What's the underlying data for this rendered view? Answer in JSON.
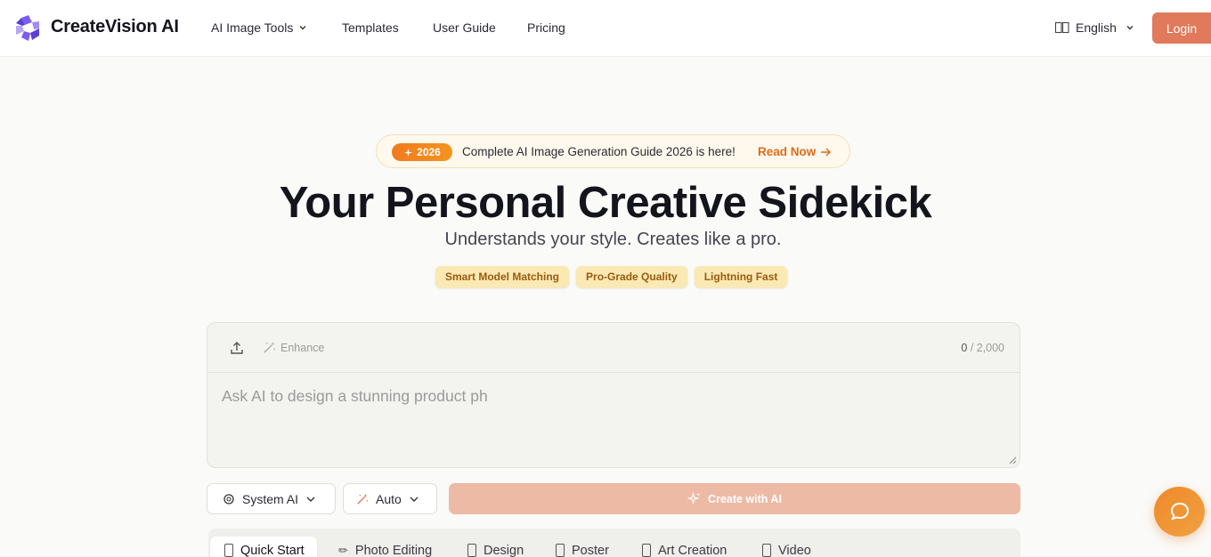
{
  "header": {
    "brand": "CreateVision AI",
    "nav": [
      {
        "label": "AI Image Tools",
        "has_dropdown": true
      },
      {
        "label": "Templates"
      },
      {
        "label": "User Guide"
      },
      {
        "label": "Pricing"
      }
    ],
    "language": "English",
    "login_label": "Login"
  },
  "announcement": {
    "badge": "2026",
    "message": "Complete AI Image Generation Guide 2026 is here!",
    "link_label": "Read Now"
  },
  "hero": {
    "title": "Your Personal Creative Sidekick",
    "subtitle": "Understands your style. Creates like a pro.",
    "tags": [
      "Smart Model Matching",
      "Pro-Grade Quality",
      "Lightning Fast"
    ]
  },
  "prompt": {
    "enhance_label": "Enhance",
    "char_count": "0",
    "char_limit": "/ 2,000",
    "placeholder": "Ask AI to design a stunning product ph",
    "value": ""
  },
  "controls": {
    "model_label": "System AI",
    "mode_label": "Auto",
    "create_label": "Create with AI"
  },
  "tabs": [
    {
      "label": "Quick Start",
      "active": true
    },
    {
      "label": "Photo Editing"
    },
    {
      "label": "Design"
    },
    {
      "label": "Poster"
    },
    {
      "label": "Art Creation"
    },
    {
      "label": "Video"
    }
  ],
  "colors": {
    "accent": "#e07a5a",
    "badge_orange": "#f07a1e",
    "tag_bg": "#fbe9b3",
    "create_btn_disabled": "#edbaa6",
    "link_orange": "#e06a19"
  },
  "icons": {
    "logo": "createvision-logo-icon",
    "language": "globe-icon",
    "upload": "upload-icon",
    "enhance": "magic-wand-icon",
    "model": "openai-icon",
    "mode": "magic-wand-icon",
    "create": "sparkle-icon",
    "chat": "chat-bubble-icon"
  }
}
